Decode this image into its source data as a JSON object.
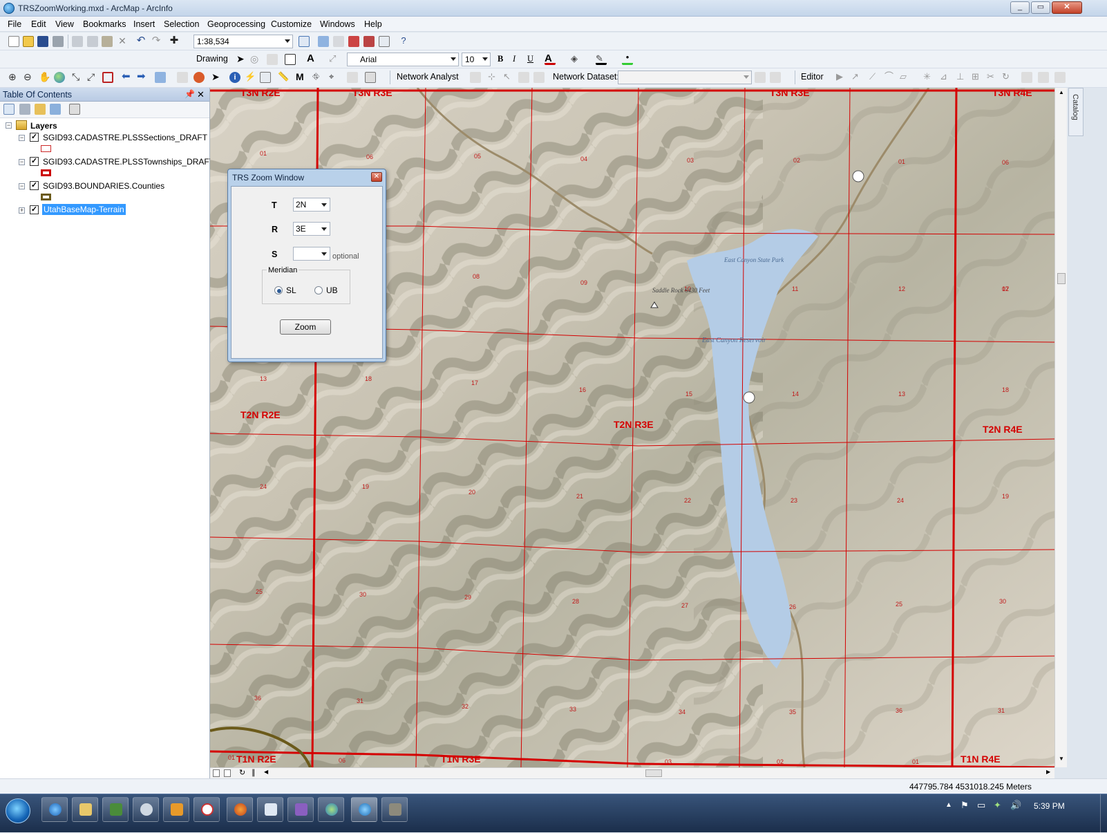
{
  "window": {
    "title": "TRSZoomWorking.mxd - ArcMap - ArcInfo"
  },
  "menu": [
    "File",
    "Edit",
    "View",
    "Bookmarks",
    "Insert",
    "Selection",
    "Geoprocessing",
    "Customize",
    "Windows",
    "Help"
  ],
  "toolbar": {
    "scale": "1:38,534",
    "drawing_label": "Drawing",
    "font_name": "Arial",
    "font_size": "10",
    "bold": "B",
    "italic": "I",
    "underline": "U",
    "network_analyst": "Network Analyst",
    "network_dataset_label": "Network Dataset:",
    "editor": "Editor"
  },
  "toc": {
    "title": "Table Of Contents",
    "root": "Layers",
    "layers": [
      {
        "name": "SGID93.CADASTRE.PLSSSections_DRAFT",
        "checked": true,
        "symbol_color": "#cc2a2a"
      },
      {
        "name": "SGID93.CADASTRE.PLSSTownships_DRAFT",
        "checked": true,
        "symbol_color": "#cc0000"
      },
      {
        "name": "SGID93.BOUNDARIES.Counties",
        "checked": true,
        "symbol_color": "#6b5a1a"
      },
      {
        "name": "UtahBaseMap-Terrain",
        "checked": true,
        "selected": true
      }
    ]
  },
  "map": {
    "township_labels": [
      "T3N R2E",
      "T3N R3E",
      "T3N R3E",
      "T3N R4E",
      "T2N R2E",
      "T2N R3E",
      "T2N R4E",
      "T1N R2E",
      "T1N R3E",
      "T1N R4E"
    ],
    "section_labels": [
      "01",
      "06",
      "05",
      "04",
      "03",
      "02",
      "01",
      "06",
      "12",
      "08",
      "09",
      "10",
      "11",
      "12",
      "07",
      "13",
      "18",
      "17",
      "16",
      "15",
      "14",
      "13",
      "18",
      "24",
      "19",
      "20",
      "21",
      "22",
      "23",
      "24",
      "19",
      "25",
      "30",
      "29",
      "28",
      "27",
      "26",
      "25",
      "30",
      "36",
      "31",
      "32",
      "33",
      "34",
      "35",
      "36",
      "31",
      "01",
      "06",
      "03",
      "02",
      "01"
    ],
    "place_labels": [
      "East Canyon State Park",
      "Saddle Rock 6430 Feet",
      "East Canyon Reservoir"
    ],
    "colors": {
      "grid": "#d40000",
      "water": "#b4cce6",
      "terrain_light": "#ddd6c8",
      "terrain_dark": "#6b6a55"
    }
  },
  "dialog": {
    "title": "TRS Zoom Window",
    "t_label": "T",
    "t_value": "2N",
    "r_label": "R",
    "r_value": "3E",
    "s_label": "S",
    "s_value": "",
    "s_hint": "optional",
    "meridian_label": "Meridian",
    "meridian_options": [
      "SL",
      "UB"
    ],
    "meridian_selected": "SL",
    "zoom_button": "Zoom"
  },
  "side_tab": "Catalog",
  "status": {
    "coordinates": "447795.784  4531018.245 Meters"
  },
  "taskbar": {
    "clock": "5:39 PM"
  }
}
